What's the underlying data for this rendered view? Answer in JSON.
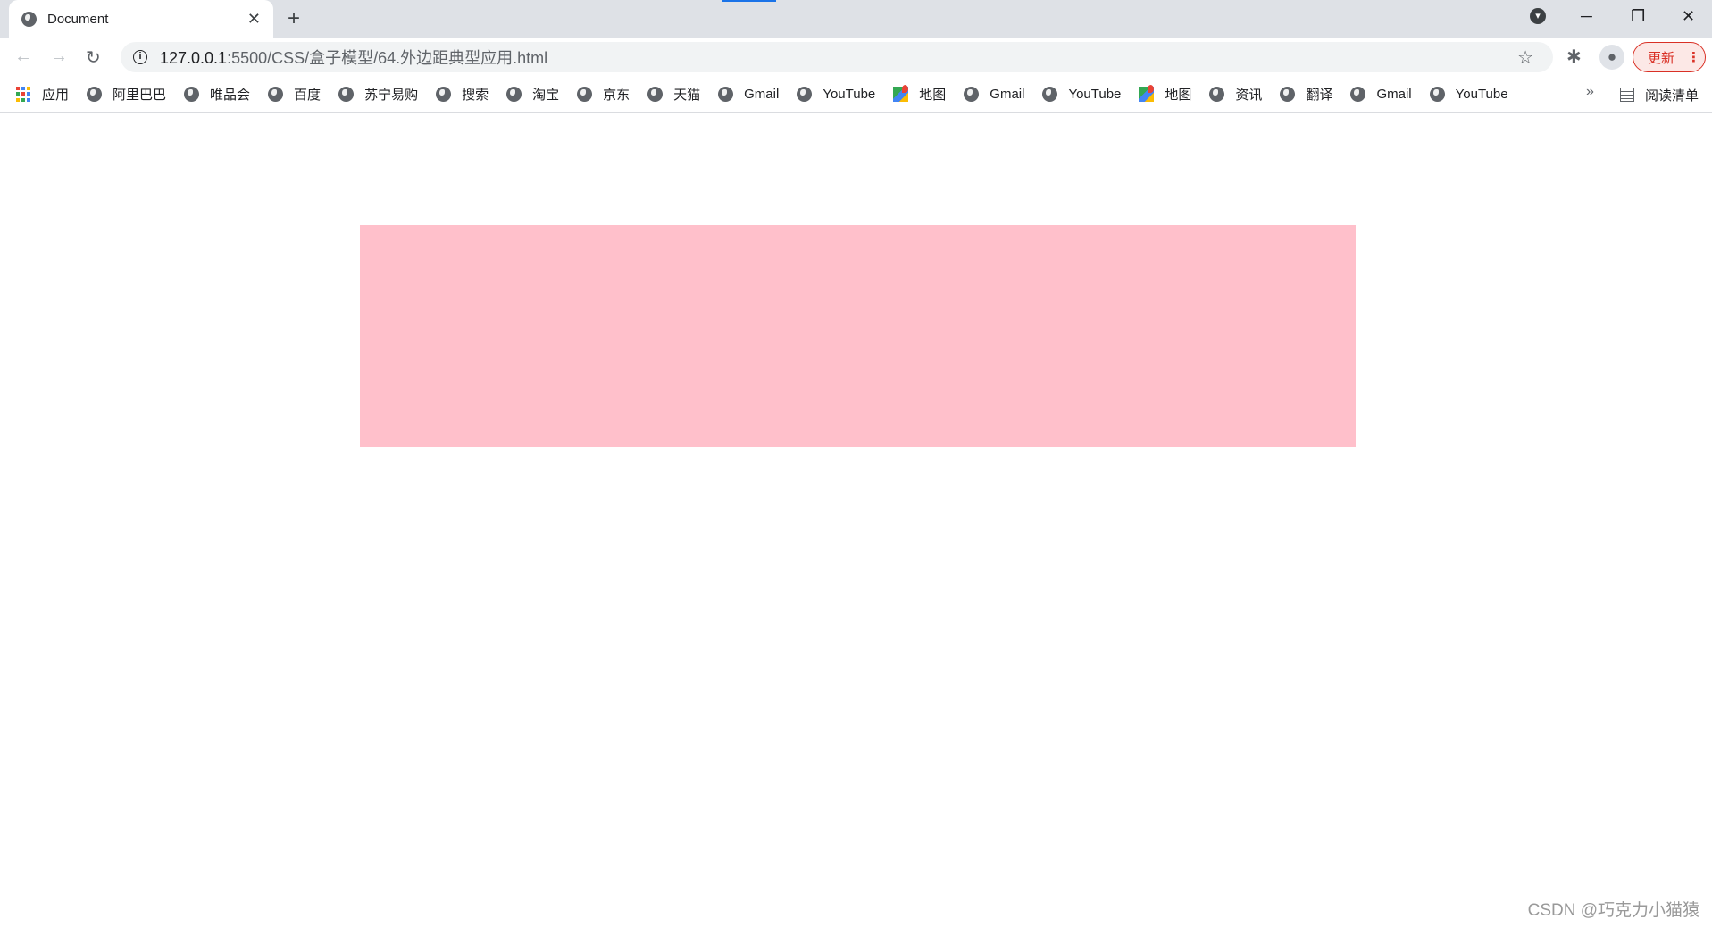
{
  "tab": {
    "title": "Document",
    "close": "✕",
    "new_tab": "+"
  },
  "window": {
    "minimize": "─",
    "restore": "❐",
    "close": "✕",
    "profile_menu": "▾"
  },
  "toolbar": {
    "back": "←",
    "forward": "→",
    "reload": "↻",
    "url_host": "127.0.0.1",
    "url_path": ":5500/CSS/盒子模型/64.外边距典型应用.html",
    "star": "☆",
    "extensions": "✱",
    "profile": "●",
    "update_label": "更新",
    "menu": "⋮"
  },
  "bookmarks": {
    "apps_label": "应用",
    "items": [
      "阿里巴巴",
      "唯品会",
      "百度",
      "苏宁易购",
      "搜索",
      "淘宝",
      "京东",
      "天猫",
      "Gmail",
      "YouTube",
      "地图",
      "Gmail",
      "YouTube",
      "地图",
      "资讯",
      "翻译",
      "Gmail",
      "YouTube"
    ],
    "more": "»",
    "reading_list": "阅读清单"
  },
  "page": {
    "box_color": "#ffc0cb"
  },
  "watermark": "CSDN @巧克力小猫猿"
}
